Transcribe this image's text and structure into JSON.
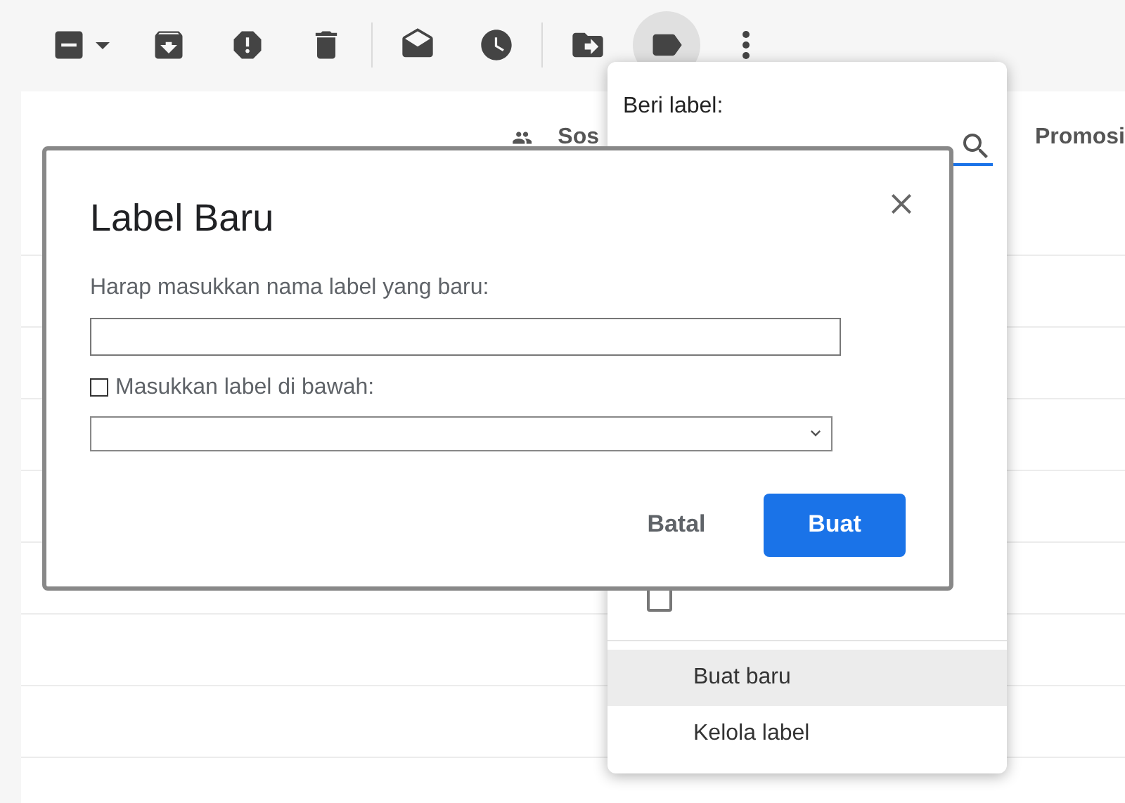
{
  "toolbar": {
    "buttons": [
      {
        "selected": false
      },
      {
        "selected": false
      },
      {
        "selected": false
      },
      {
        "selected": false
      },
      {
        "selected": false
      },
      {
        "selected": false
      },
      {
        "selected": false
      },
      {
        "selected": true
      },
      {
        "selected": false
      }
    ]
  },
  "tabs": [
    {
      "label": "Sos"
    },
    {
      "label": "Promosi"
    }
  ],
  "label_menu": {
    "title": "Beri label:",
    "items": [
      {
        "kind": "checkbox",
        "checked": false
      }
    ],
    "actions": [
      {
        "label": "Buat baru",
        "selected": true
      },
      {
        "label": "Kelola label",
        "selected": false
      }
    ]
  },
  "dialog": {
    "title": "Label Baru",
    "name_label": "Harap masukkan nama label yang baru:",
    "nest": {
      "label": "Masukkan label di bawah:",
      "checked": false
    },
    "buttons": [
      {
        "label": "Batal",
        "kind": "text"
      },
      {
        "label": "Buat",
        "kind": "primary"
      }
    ]
  }
}
